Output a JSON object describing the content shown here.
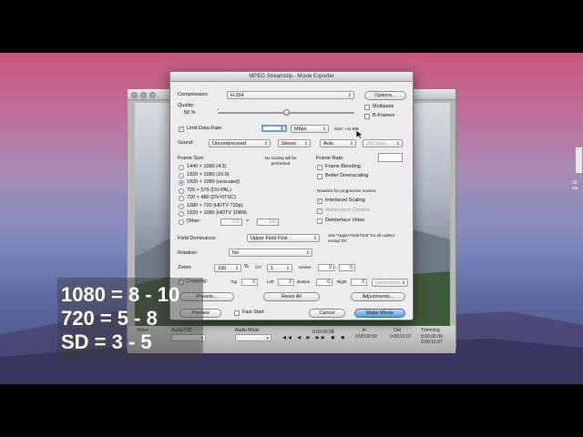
{
  "dialog": {
    "title": "MPEG Streamclip - Movie Exporter",
    "compression_label": "Compression:",
    "compression_value": "H.264",
    "options_button": "Options...",
    "quality_label": "Quality:",
    "quality_value": "50 %",
    "multipass_label": "Multipass",
    "bframes_label": "B-Frames",
    "limit_data_rate_label": "Limit Data Rate:",
    "limit_data_rate_checked": true,
    "data_rate_value": "8",
    "data_rate_unit": "Mbps",
    "size_text": "Size: ~11 MB",
    "sound_label": "Sound:",
    "sound_value": "Uncompressed",
    "sound_channels": "Stereo",
    "sound_rate": "Auto",
    "sound_bitrate": "256 kbps",
    "frame_size_label": "Frame Size:",
    "no_scaling_note": "No scaling will be performed",
    "frame_rate_label": "Frame Rate:",
    "frame_sizes": [
      {
        "label": "1440 × 1080  (4:3)",
        "selected": false
      },
      {
        "label": "1920 × 1080  (16:9)",
        "selected": false
      },
      {
        "label": "1920 × 1080  (unscaled)",
        "selected": true
      },
      {
        "label": "720 × 576  (DV-PAL)",
        "selected": false
      },
      {
        "label": "720 × 480  (DV-NTSC)",
        "selected": false
      },
      {
        "label": "1280 × 720  (HDTV 720p)",
        "selected": false
      },
      {
        "label": "1920 × 1080  (HDTV 1080i)",
        "selected": false
      },
      {
        "label": "Other:",
        "selected": false
      }
    ],
    "other_width": "320",
    "other_x": "×",
    "other_height": "240",
    "frame_blending_label": "Frame Blending",
    "better_downscaling_label": "Better Downscaling",
    "deselect_note": "Deselect for progressive movies:",
    "interlaced_scaling_label": "Interlaced Scaling",
    "reinterlace_chroma_label": "Reinterlace Chroma",
    "deinterlace_video_label": "Deinterlace Video",
    "field_dominance_label": "Field Dominance:",
    "field_dominance_value": "Upper Field First",
    "field_dominance_note": "Use \"Upper Field First\" for all codecs except DV",
    "rotation_label": "Rotation:",
    "rotation_value": "No",
    "zoom_label": "Zoom:",
    "zoom_value": "100",
    "zoom_unit": "%",
    "xy_label": "X/Y",
    "xy_value": "1",
    "center_label": "Center",
    "center_x": "0",
    "center_y": "0",
    "cropping_label": "Cropping:",
    "top_label": "Top",
    "top_value": "0",
    "left_label": "Left",
    "left_value": "0",
    "bottom_label": "Bottom",
    "bottom_value": "0",
    "right_label": "Right",
    "right_value": "0",
    "destination_value": "Destination",
    "presets_button": "Presets...",
    "reset_all_button": "Reset All",
    "adjustments_button": "Adjustments...",
    "preview_button": "Preview",
    "fast_start_label": "Fast Start",
    "cancel_button": "Cancel",
    "make_movie_button": "Make Movie"
  },
  "player": {
    "video_label": "Video",
    "audio_label": "Audio PID",
    "audio_mode_label": "Audio Mode",
    "time_display": "0:00:00.08",
    "in_label": "In",
    "out_label": "Out",
    "in_time": "0:00:00.00",
    "out_time": "0:00:10.07",
    "trimming_label": "Trimming",
    "trim_start": "0:00:00.00",
    "trim_end": "0:00:10.07"
  },
  "overlay": {
    "line1": "1080 = 8 - 10",
    "line2": "720 = 5 - 8",
    "line3": "SD = 3 - 5"
  },
  "side_icon_label": "00 clo"
}
